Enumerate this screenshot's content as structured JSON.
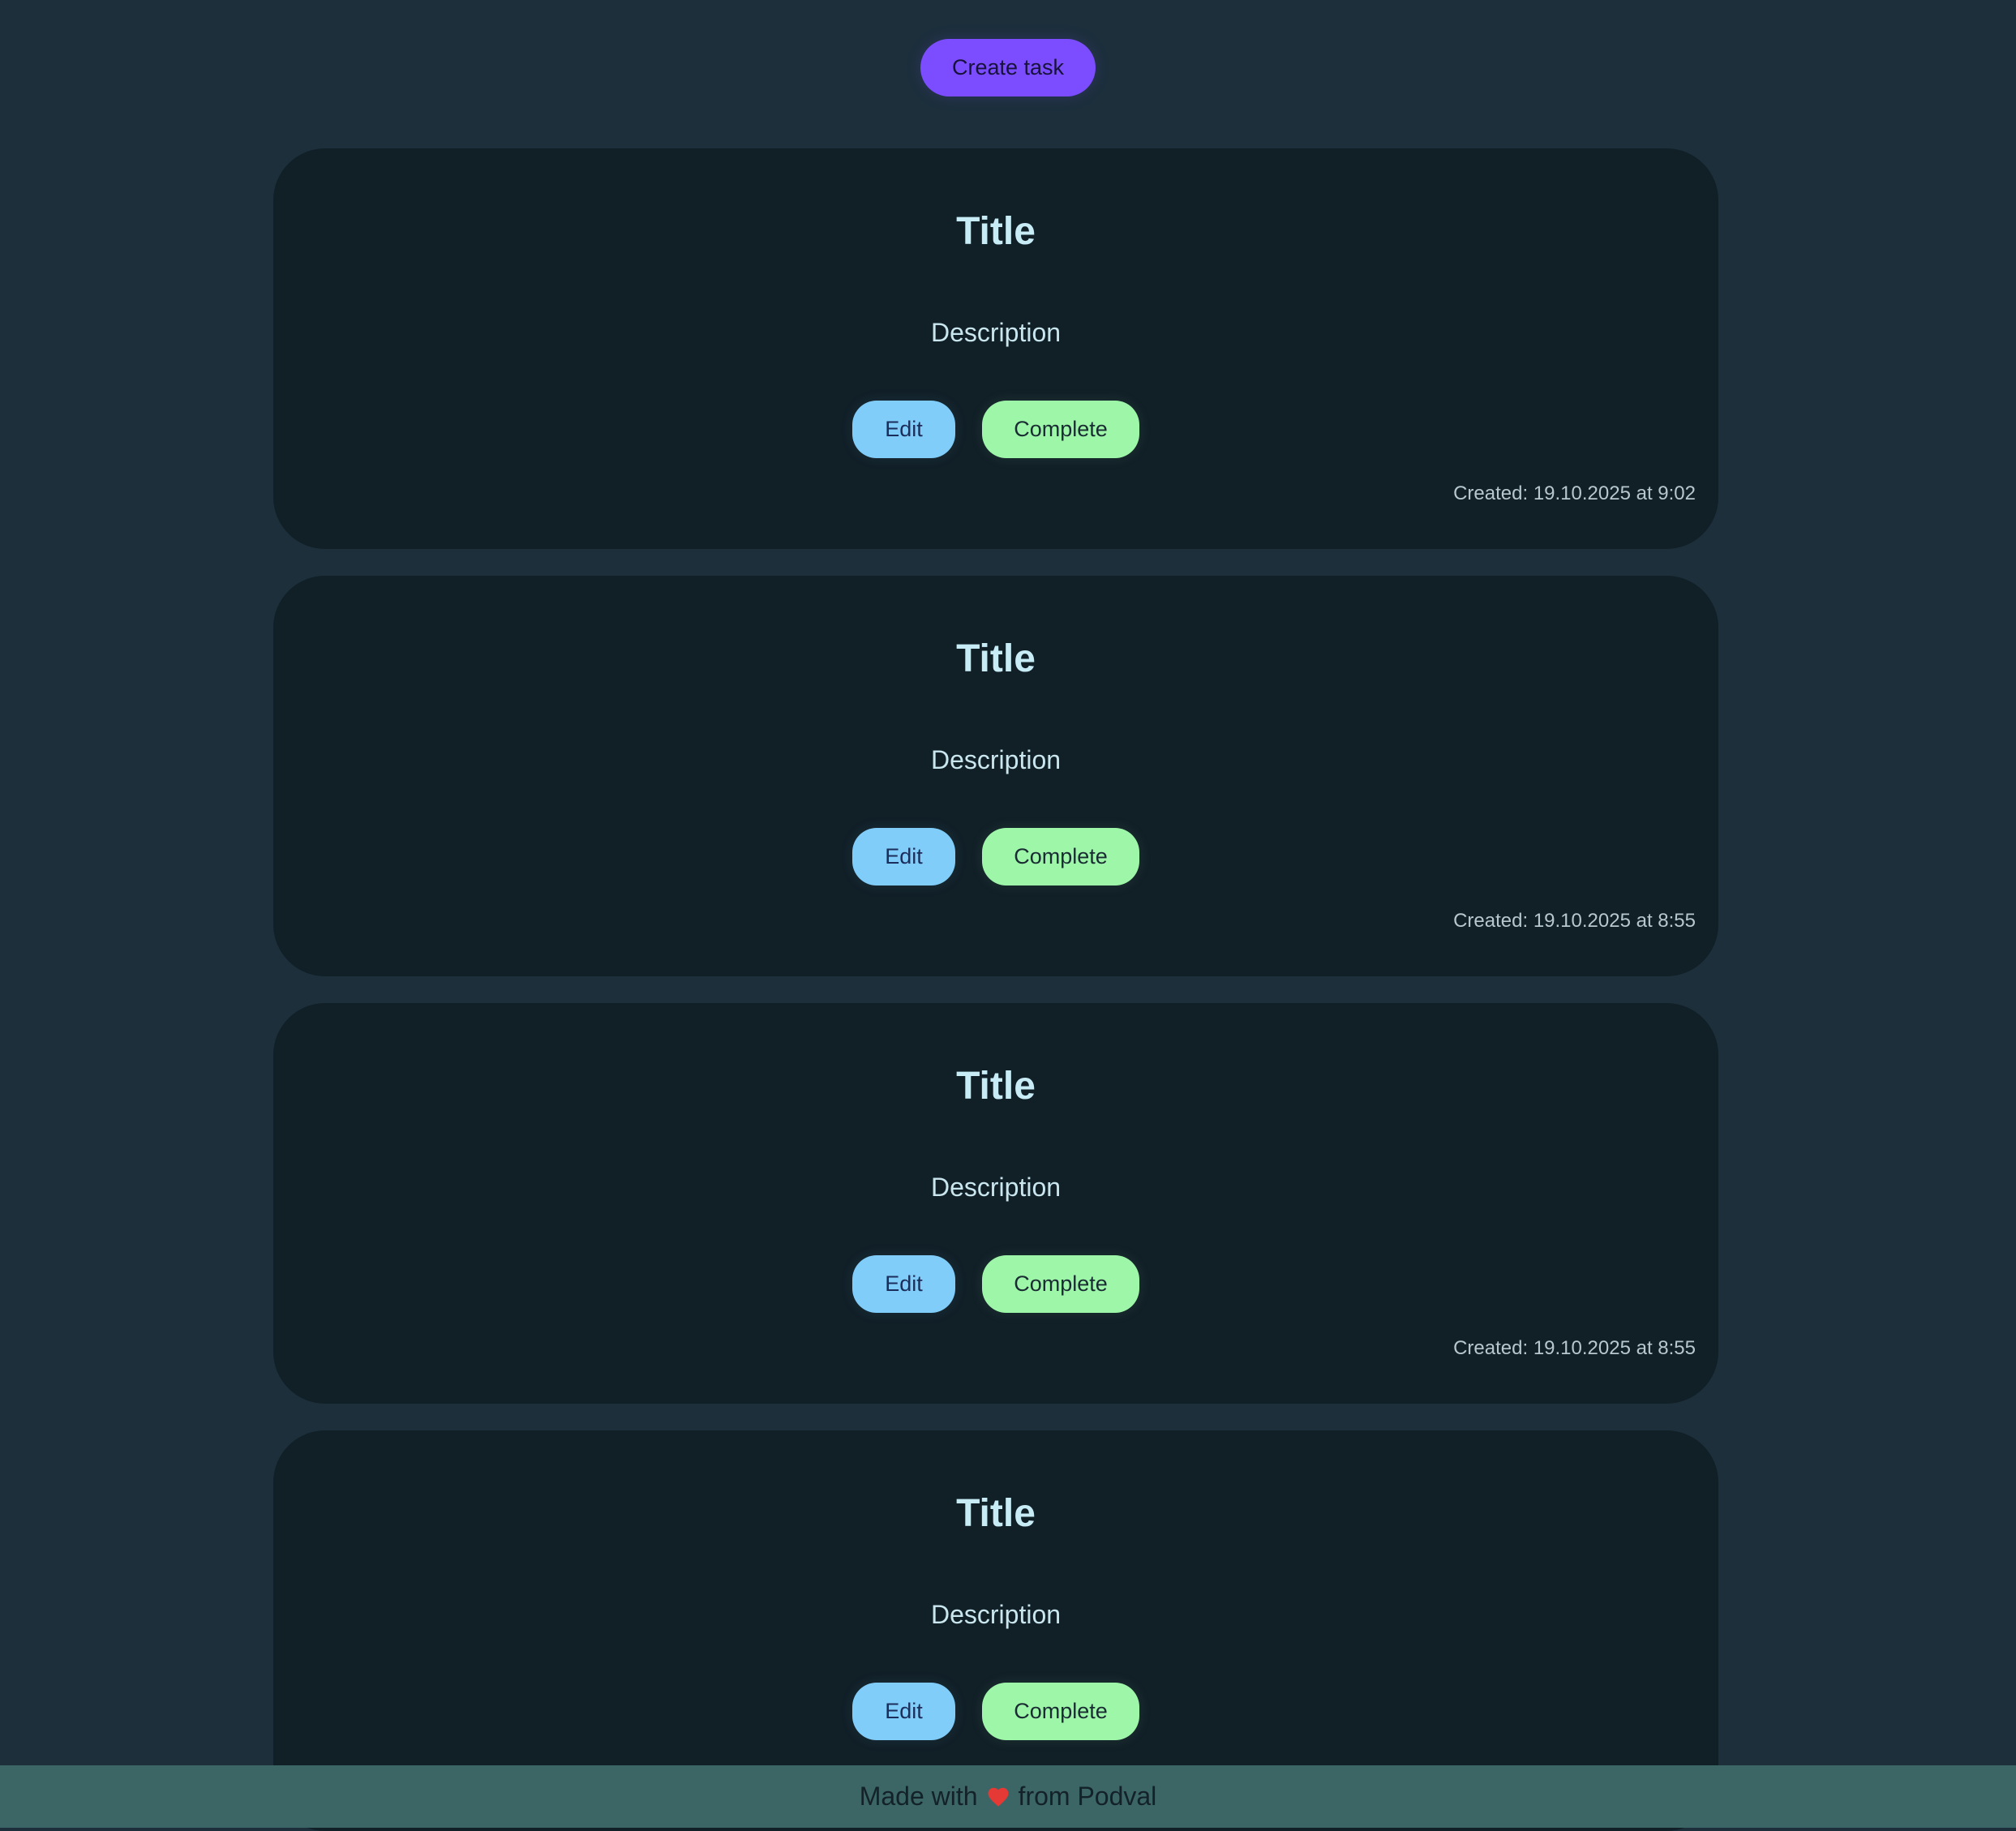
{
  "header": {
    "create_button_label": "Create task"
  },
  "tasks": [
    {
      "title": "Title",
      "description": "Description",
      "edit_label": "Edit",
      "complete_label": "Complete",
      "created": "Created: 19.10.2025 at 9:02"
    },
    {
      "title": "Title",
      "description": "Description",
      "edit_label": "Edit",
      "complete_label": "Complete",
      "created": "Created: 19.10.2025 at 8:55"
    },
    {
      "title": "Title",
      "description": "Description",
      "edit_label": "Edit",
      "complete_label": "Complete",
      "created": "Created: 19.10.2025 at 8:55"
    },
    {
      "title": "Title",
      "description": "Description",
      "edit_label": "Edit",
      "complete_label": "Complete",
      "created": ""
    }
  ],
  "footer": {
    "prefix": "Made with",
    "icon": "heart-icon",
    "suffix": "from Podval"
  },
  "colors": {
    "background": "#1c2f3b",
    "card": "#111f27",
    "create_button": "#7c4dff",
    "edit_button": "#80cdfa",
    "complete_button": "#9ef7a8",
    "footer": "#3c6565",
    "heart": "#e53935"
  }
}
